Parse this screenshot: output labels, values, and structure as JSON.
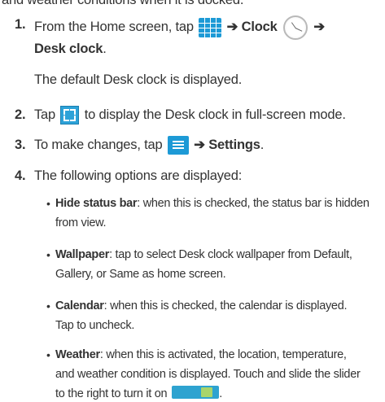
{
  "intro_fragment": "and weather conditions when it is docked.",
  "steps": [
    {
      "num": "1.",
      "a": "From the Home screen, tap",
      "arrow1": "➔ Clock",
      "arrow2": "➔",
      "b": "Desk clock",
      "c": ".",
      "note": "The default Desk clock is displayed."
    },
    {
      "num": "2.",
      "a": "Tap",
      "b": "to display the Desk clock in full-screen mode."
    },
    {
      "num": "3.",
      "a": "To make changes, tap",
      "b": "➔ Settings",
      "c": "."
    },
    {
      "num": "4.",
      "a": "The following options are displayed:"
    }
  ],
  "options": [
    {
      "term": "Hide status bar",
      "desc1": ": when this is checked, the status bar is hidden",
      "desc2": "from view."
    },
    {
      "term": "Wallpaper",
      "desc1": ": tap to select Desk clock wallpaper from Default,",
      "desc2": "Gallery, or Same as home screen."
    },
    {
      "term": "Calendar",
      "desc1": ": when this is checked, the calendar is displayed.",
      "desc2": "Tap to uncheck."
    },
    {
      "term": "Weather",
      "desc1": ": when this is activated, the location, temperature,",
      "desc2": "and weather condition is displayed. Touch and slide the slider",
      "desc3": "to the right to turn it on",
      "desc3_end": "."
    }
  ],
  "icons": [
    "apps-grid-icon",
    "clock-icon",
    "fullscreen-icon",
    "menu-icon",
    "toggle-switch-icon"
  ],
  "colors": {
    "icon_blue": "#1d9ad6",
    "toggle_green": "#a8d56b"
  }
}
